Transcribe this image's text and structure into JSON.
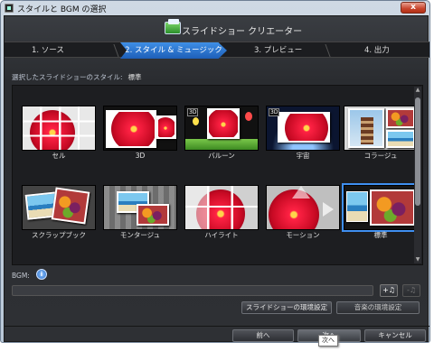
{
  "window": {
    "title": "スタイルと BGM の選択",
    "close_label": "x"
  },
  "header": {
    "app_title": "スライドショー クリエーター"
  },
  "steps": [
    {
      "label": "1. ソース",
      "active": false
    },
    {
      "label": "2. スタイル & ミュージック",
      "active": true
    },
    {
      "label": "3. プレビュー",
      "active": false
    },
    {
      "label": "4. 出力",
      "active": false
    }
  ],
  "styles": {
    "label": "選択したスライドショーのスタイル:",
    "selected": "標準",
    "items": [
      {
        "name": "セル",
        "badge": ""
      },
      {
        "name": "3D",
        "badge": ""
      },
      {
        "name": "バルーン",
        "badge": "3D"
      },
      {
        "name": "宇宙",
        "badge": "3D"
      },
      {
        "name": "コラージュ",
        "badge": ""
      },
      {
        "name": "スクラップブック",
        "badge": ""
      },
      {
        "name": "モンタージュ",
        "badge": ""
      },
      {
        "name": "ハイライト",
        "badge": ""
      },
      {
        "name": "モーション",
        "badge": ""
      },
      {
        "name": "標準",
        "badge": "",
        "selected": true
      }
    ]
  },
  "bgm": {
    "label": "BGM:",
    "info_icon_text": "i",
    "add_button": "+♫",
    "remove_button": "-♫"
  },
  "settings_buttons": {
    "slideshow_settings": "スライドショーの環境設定",
    "music_settings": "音楽の環境設定"
  },
  "footer": {
    "back": "前へ",
    "next": "次へ",
    "cancel": "キャンセル"
  },
  "tooltip": {
    "text": "次へ"
  },
  "colors": {
    "accent": "#2f7fe0",
    "panel": "#2e3034"
  },
  "icons": {
    "info": "info-icon",
    "add_music": "add-music-icon",
    "remove_music": "remove-music-icon"
  }
}
